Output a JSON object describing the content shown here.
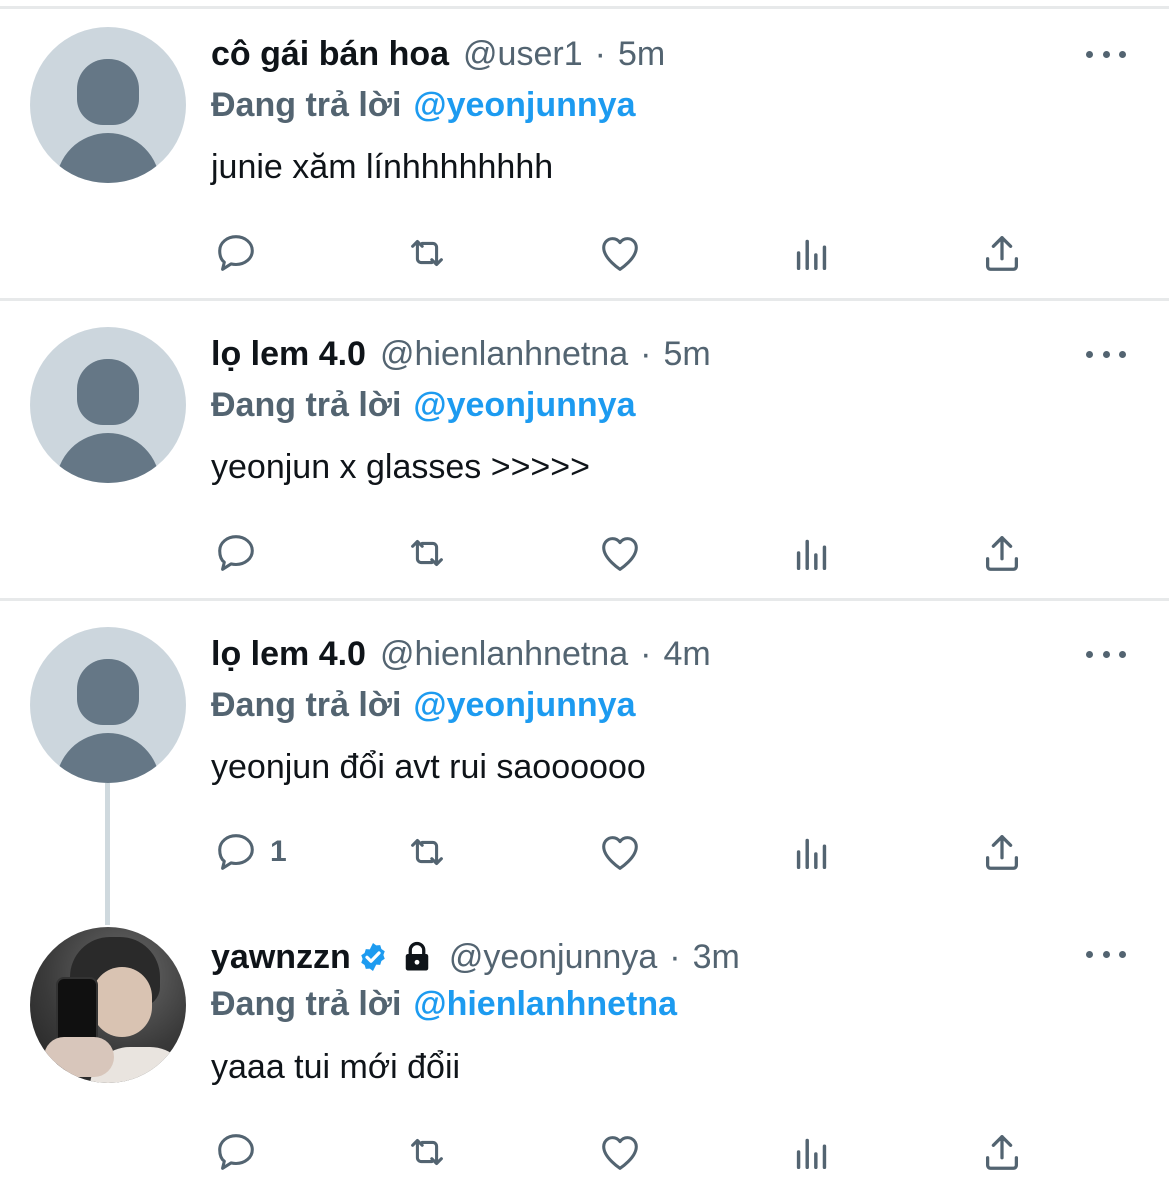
{
  "tweets": [
    {
      "display_name": "cô gái bán hoa",
      "handle": "@user1",
      "separator": "·",
      "time": "5m",
      "replying_label": "Đang trả lời",
      "replying_to": "@yeonjunnya",
      "text": "junie xăm línhhhhhhhh",
      "reply_count": "",
      "avatar": "default-avatar"
    },
    {
      "display_name": "lọ lem 4.0",
      "handle": "@hienlanhnetna",
      "separator": "·",
      "time": "5m",
      "replying_label": "Đang trả lời",
      "replying_to": "@yeonjunnya",
      "text": "yeonjun x glasses >>>>>",
      "reply_count": "",
      "avatar": "default-avatar"
    },
    {
      "display_name": "lọ lem 4.0",
      "handle": "@hienlanhnetna",
      "separator": "·",
      "time": "4m",
      "replying_label": "Đang trả lời",
      "replying_to": "@yeonjunnya",
      "text": "yeonjun đổi avt rui saoooooo",
      "reply_count": "1",
      "avatar": "default-avatar"
    },
    {
      "display_name": "yawnzzn",
      "handle": "@yeonjunnya",
      "separator": "·",
      "time": "3m",
      "replying_label": "Đang trả lời",
      "replying_to": "@hienlanhnetna",
      "text": "yaaa tui mới đổii",
      "reply_count": "",
      "verified": true,
      "protected": true,
      "avatar": "photo-avatar"
    }
  ],
  "icons": [
    "reply-icon",
    "retweet-icon",
    "like-icon",
    "analytics-icon",
    "share-icon",
    "more-icon",
    "verified-badge-icon",
    "lock-icon"
  ],
  "colors": {
    "text": "#0f1419",
    "secondary": "#536471",
    "accent": "#1d9bf0",
    "divider": "#e7e9ea",
    "avatar_bg": "#ccd6dd",
    "avatar_fg": "#657786"
  }
}
